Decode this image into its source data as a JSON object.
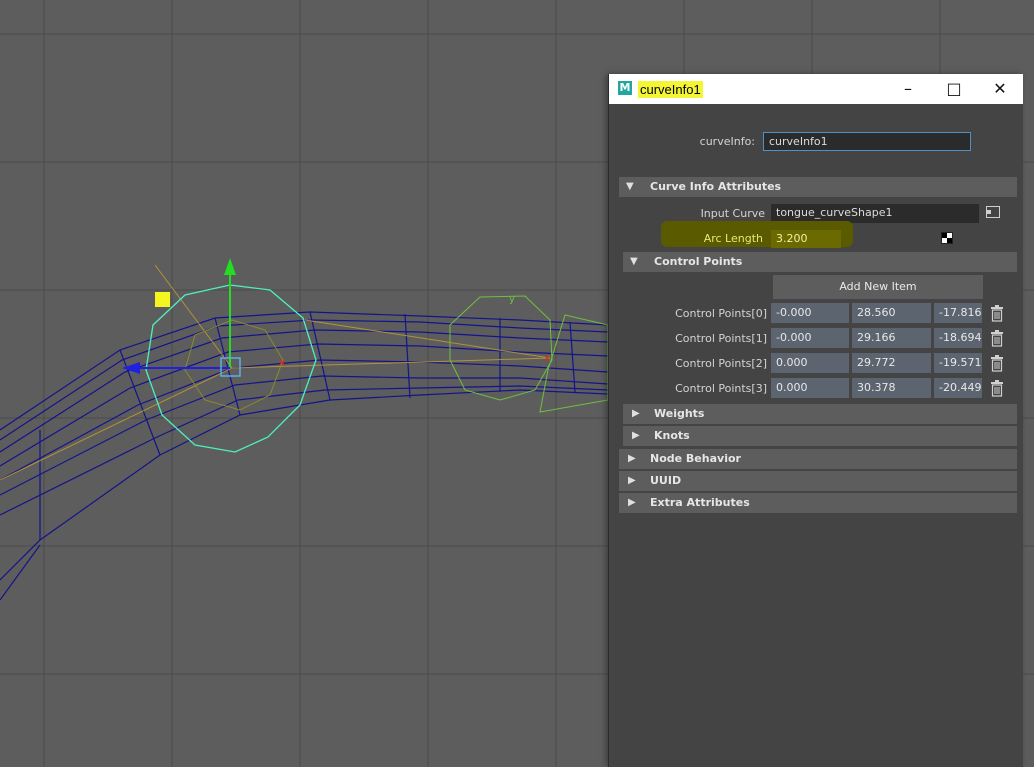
{
  "window": {
    "title": "curveInfo1",
    "app_icon": "M"
  },
  "node": {
    "label": "curveInfo:",
    "value": "curveInfo1"
  },
  "sections": {
    "curve_info": "Curve Info Attributes",
    "control_points": "Control Points",
    "weights": "Weights",
    "knots": "Knots",
    "node_behavior": "Node Behavior",
    "uuid": "UUID",
    "extra": "Extra Attributes"
  },
  "attributes": {
    "input_curve_label": "Input Curve",
    "input_curve_value": "tongue_curveShape1",
    "arc_length_label": "Arc Length",
    "arc_length_value": "3.200"
  },
  "add_item_label": "Add New Item",
  "control_points": [
    {
      "label": "Control Points[0]",
      "x": "-0.000",
      "y": "28.560",
      "z": "-17.816"
    },
    {
      "label": "Control Points[1]",
      "x": "-0.000",
      "y": "29.166",
      "z": "-18.694"
    },
    {
      "label": "Control Points[2]",
      "x": "0.000",
      "y": "29.772",
      "z": "-19.571"
    },
    {
      "label": "Control Points[3]",
      "x": "0.000",
      "y": "30.378",
      "z": "-20.449"
    }
  ],
  "colors": {
    "highlight": "#f5f537",
    "arc_highlight": "#5a5a00",
    "maya_teal": "#23a6a0",
    "wire": "#101080"
  }
}
